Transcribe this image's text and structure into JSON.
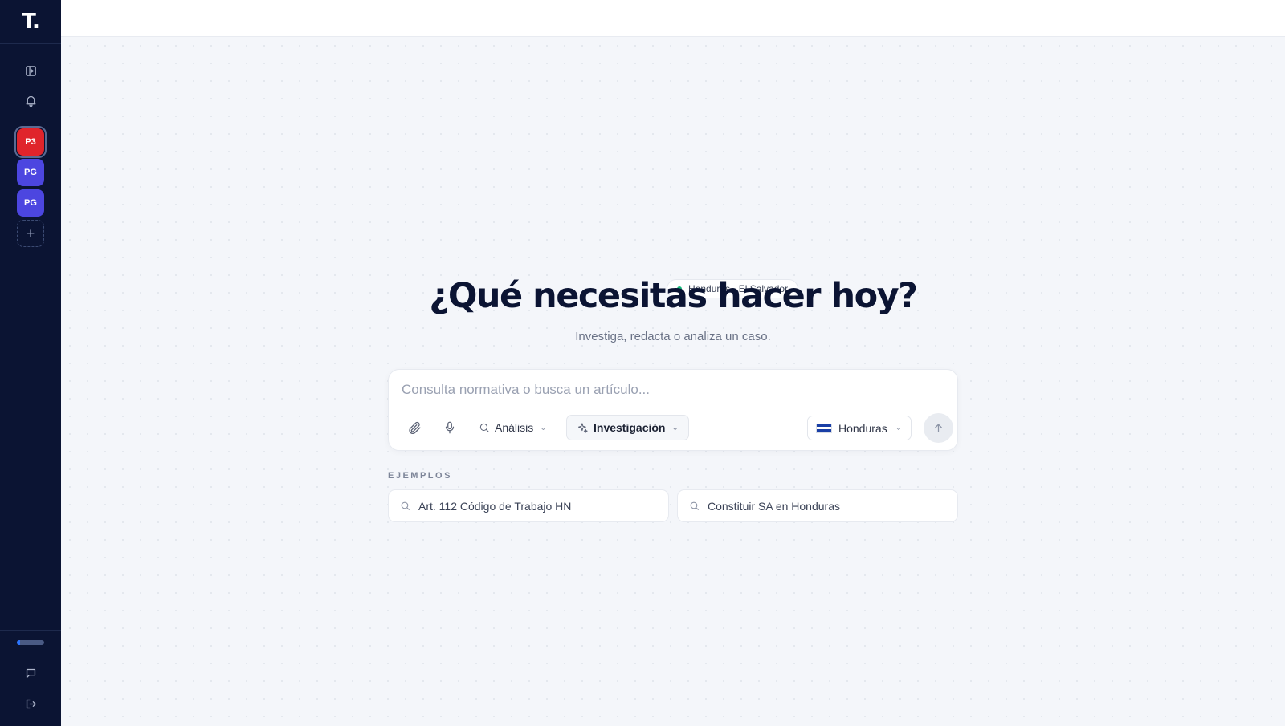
{
  "sidebar": {
    "logo": "T.",
    "workspaces": [
      {
        "label": "P3",
        "color": "#e0242b",
        "active": true
      },
      {
        "label": "PG",
        "color": "#4c46e0",
        "active": false
      },
      {
        "label": "PG",
        "color": "#4c46e0",
        "active": false
      }
    ],
    "add_icon": "plus-icon",
    "progress": 0.12
  },
  "main": {
    "region": "Honduras · El Salvador",
    "headline": "¿Qué necesitas hacer hoy?",
    "subtitle": "Investiga, redacta o analiza un caso.",
    "composer": {
      "placeholder": "Consulta normativa o busca un artículo...",
      "value": "",
      "mode_analysis": "Análisis",
      "mode_research": "Investigación",
      "country": "Honduras"
    },
    "examples_label": "EJEMPLOS",
    "examples": [
      "Art. 112 Código de Trabajo HN",
      "Constituir SA en Honduras"
    ]
  },
  "colors": {
    "sidebar_bg": "#0b1433",
    "accent_green": "#14b87a",
    "progress": "#2b74ff"
  }
}
